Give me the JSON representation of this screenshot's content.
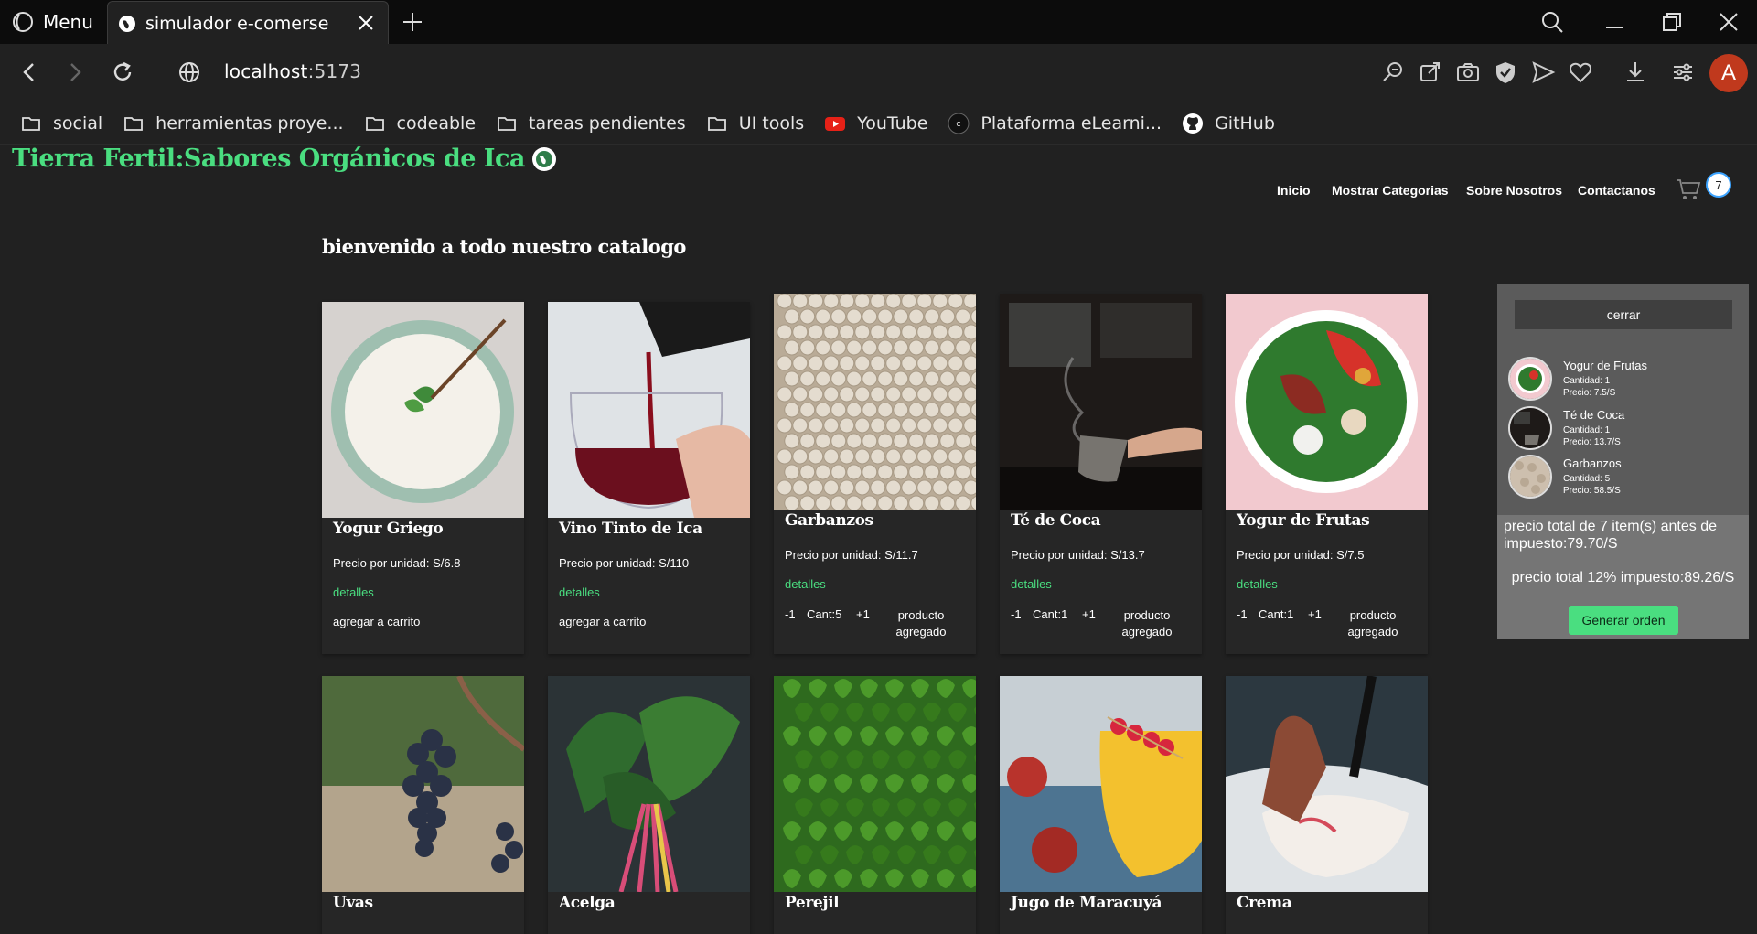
{
  "browser": {
    "menu_label": "Menu",
    "tab_title": "simulador e-comerse",
    "url_host": "localhost",
    "url_port": ":5173",
    "bookmarks": [
      {
        "label": "social",
        "icon": "folder-icon"
      },
      {
        "label": "herramientas proye...",
        "icon": "folder-icon"
      },
      {
        "label": "codeable",
        "icon": "folder-icon"
      },
      {
        "label": "tareas pendientes",
        "icon": "folder-icon"
      },
      {
        "label": "UI tools",
        "icon": "folder-icon"
      },
      {
        "label": "YouTube",
        "icon": "youtube-icon"
      },
      {
        "label": "Plataforma eLearni...",
        "icon": "codea-icon"
      },
      {
        "label": "GitHub",
        "icon": "github-icon"
      }
    ],
    "avatar_letter": "A"
  },
  "site": {
    "title": "Tierra Fertil:Sabores Orgánicos de Ica",
    "nav": [
      "Inicio",
      "Mostrar Categorias",
      "Sobre Nosotros",
      "Contactanos"
    ],
    "cart_count": "7",
    "catalog_title": "bienvenido a todo nuestro catalogo"
  },
  "products": [
    {
      "name": "Yogur Griego",
      "price": "Precio por unidad: S/6.8",
      "details": "detalles",
      "action": "agregar a carrito"
    },
    {
      "name": "Vino Tinto de Ica",
      "price": "Precio por unidad: S/110",
      "details": "detalles",
      "action": "agregar a carrito"
    },
    {
      "name": "Garbanzos",
      "price": "Precio por unidad: S/11.7",
      "details": "detalles",
      "minus": "-1",
      "qty": "Cant:5",
      "plus": "+1",
      "status": "producto agregado"
    },
    {
      "name": "Té de Coca",
      "price": "Precio por unidad: S/13.7",
      "details": "detalles",
      "minus": "-1",
      "qty": "Cant:1",
      "plus": "+1",
      "status": "producto agregado"
    },
    {
      "name": "Yogur de Frutas",
      "price": "Precio por unidad: S/7.5",
      "details": "detalles",
      "minus": "-1",
      "qty": "Cant:1",
      "plus": "+1",
      "status": "producto agregado"
    },
    {
      "name": "Uvas"
    },
    {
      "name": "Acelga"
    },
    {
      "name": "Perejil"
    },
    {
      "name": "Jugo de Maracuyá"
    },
    {
      "name": "Crema"
    }
  ],
  "cart": {
    "close_label": "cerrar",
    "items": [
      {
        "name": "Yogur de Frutas",
        "qty": "Cantidad: 1",
        "price": "Precio: 7.5/S"
      },
      {
        "name": "Té de Coca",
        "qty": "Cantidad: 1",
        "price": "Precio: 13.7/S"
      },
      {
        "name": "Garbanzos",
        "qty": "Cantidad: 5",
        "price": "Precio: 58.5/S"
      }
    ],
    "total_before_tax": "precio total de 7 item(s) antes de impuesto:79.70/S",
    "total_with_tax": "precio total 12% impuesto:89.26/S",
    "order_button": "Generar orden"
  },
  "colors": {
    "accent_green": "#4ade80",
    "badge_border": "#3ba3ff",
    "avatar": "#c0391d"
  }
}
